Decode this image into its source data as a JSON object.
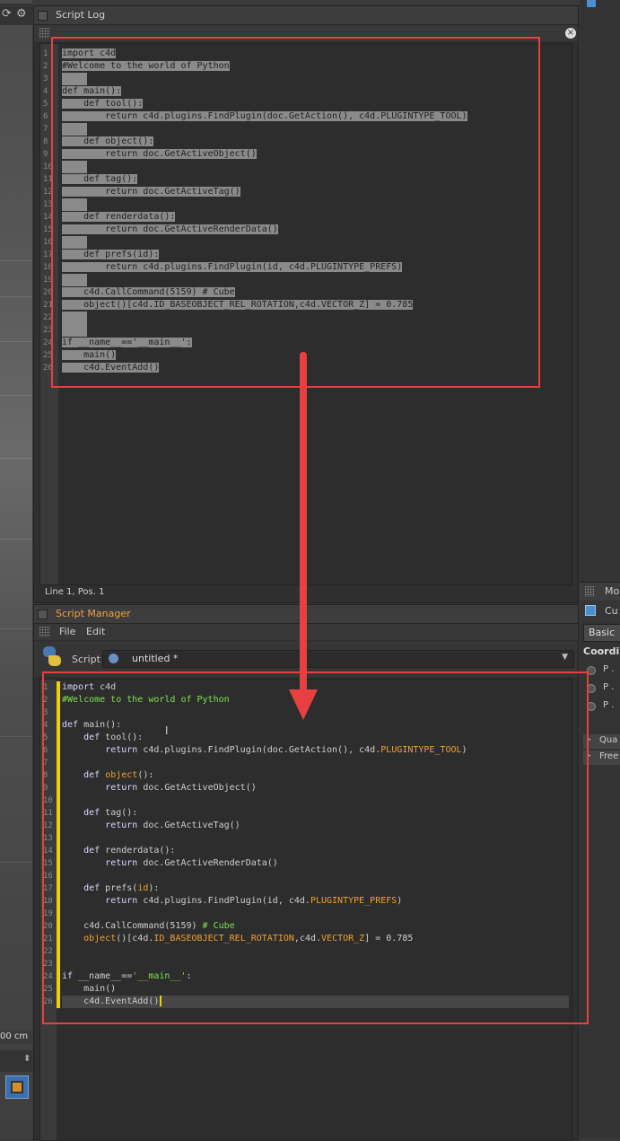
{
  "script_log": {
    "title": "Script Log",
    "status": "Line 1, Pos. 1",
    "lines": [
      "import c4d",
      "#Welcome to the world of Python",
      "",
      "def main():",
      "    def tool():",
      "        return c4d.plugins.FindPlugin(doc.GetAction(), c4d.PLUGINTYPE_TOOL)",
      "",
      "    def object():",
      "        return doc.GetActiveObject()",
      "",
      "    def tag():",
      "        return doc.GetActiveTag()",
      "",
      "    def renderdata():",
      "        return doc.GetActiveRenderData()",
      "",
      "    def prefs(id):",
      "        return c4d.plugins.FindPlugin(id, c4d.PLUGINTYPE_PREFS)",
      "",
      "    c4d.CallCommand(5159) # Cube",
      "    object()[c4d.ID_BASEOBJECT_REL_ROTATION,c4d.VECTOR_Z] = 0.785",
      "",
      "",
      "if __name__=='__main__':",
      "    main()",
      "    c4d.EventAdd()"
    ],
    "line_numbers": [
      "1",
      "2",
      "3",
      "4",
      "5",
      "6",
      "7",
      "8",
      "9",
      "10",
      "11",
      "12",
      "13",
      "14",
      "15",
      "16",
      "17",
      "18",
      "19",
      "20",
      "21",
      "22",
      "23",
      "24",
      "25",
      "26"
    ]
  },
  "script_manager": {
    "title": "Script Manager",
    "menu": [
      "File",
      "Edit"
    ],
    "script_label": "Script",
    "script_name": "untitled *",
    "line_numbers": [
      "1",
      "2",
      "3",
      "4",
      "5",
      "6",
      "7",
      "8",
      "9",
      "10",
      "11",
      "12",
      "13",
      "14",
      "15",
      "16",
      "17",
      "18",
      "19",
      "20",
      "21",
      "22",
      "23",
      "24",
      "25",
      "26"
    ]
  },
  "right_panel": {
    "header_label": "Mo",
    "object_label": "Cu",
    "tab_basic": "Basic",
    "section": "Coordir",
    "p1": "P .",
    "p2": "P .",
    "p3": "P .",
    "item_qua": "Qua",
    "item_free": "Free"
  },
  "left_strip": {
    "unit_label": "00 cm"
  },
  "colors": {
    "highlight_box": "#e84040",
    "arrow": "#e84040",
    "title_active": "#f0a040",
    "string_green": "#7fe04f",
    "constant_orange": "#f0a030",
    "cursor_yellow": "#f0d000"
  }
}
